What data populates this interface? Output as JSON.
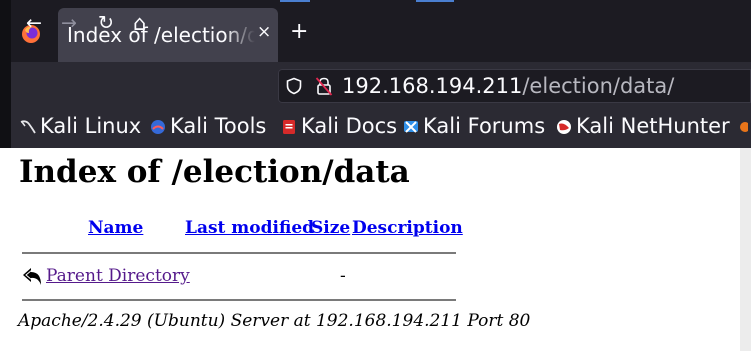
{
  "browser": {
    "tab": {
      "title": "Index of /election/data/",
      "close": "×"
    },
    "new_tab": "+",
    "nav": {
      "back": "←",
      "forward": "→",
      "reload": "↻",
      "home": "⌂"
    },
    "url": {
      "host": "192.168.194.211",
      "path": "/election/data/"
    },
    "bookmarks": [
      {
        "label": "Kali Linux",
        "icon": "kali-dragon-icon"
      },
      {
        "label": "Kali Tools",
        "icon": "kali-tools-icon"
      },
      {
        "label": "Kali Docs",
        "icon": "kali-docs-icon"
      },
      {
        "label": "Kali Forums",
        "icon": "kali-forums-icon"
      },
      {
        "label": "Kali NetHunter",
        "icon": "kali-nethunter-icon"
      }
    ],
    "colors": {
      "tab_strip": "#1c1b22",
      "toolbar": "#2b2a33",
      "active_tab": "#42414d",
      "accent": "#4a7fd0"
    }
  },
  "page": {
    "heading": "Index of /election/data",
    "columns": {
      "name": "Name",
      "modified": "Last modified",
      "size": "Size",
      "description": "Description"
    },
    "rows": [
      {
        "icon": "back-arrow-icon",
        "name": "Parent Directory",
        "modified": "",
        "size": "-",
        "description": ""
      }
    ],
    "address": "Apache/2.4.29 (Ubuntu) Server at 192.168.194.211 Port 80",
    "colors": {
      "link": "#0000ee",
      "visited": "#551a8b"
    }
  }
}
